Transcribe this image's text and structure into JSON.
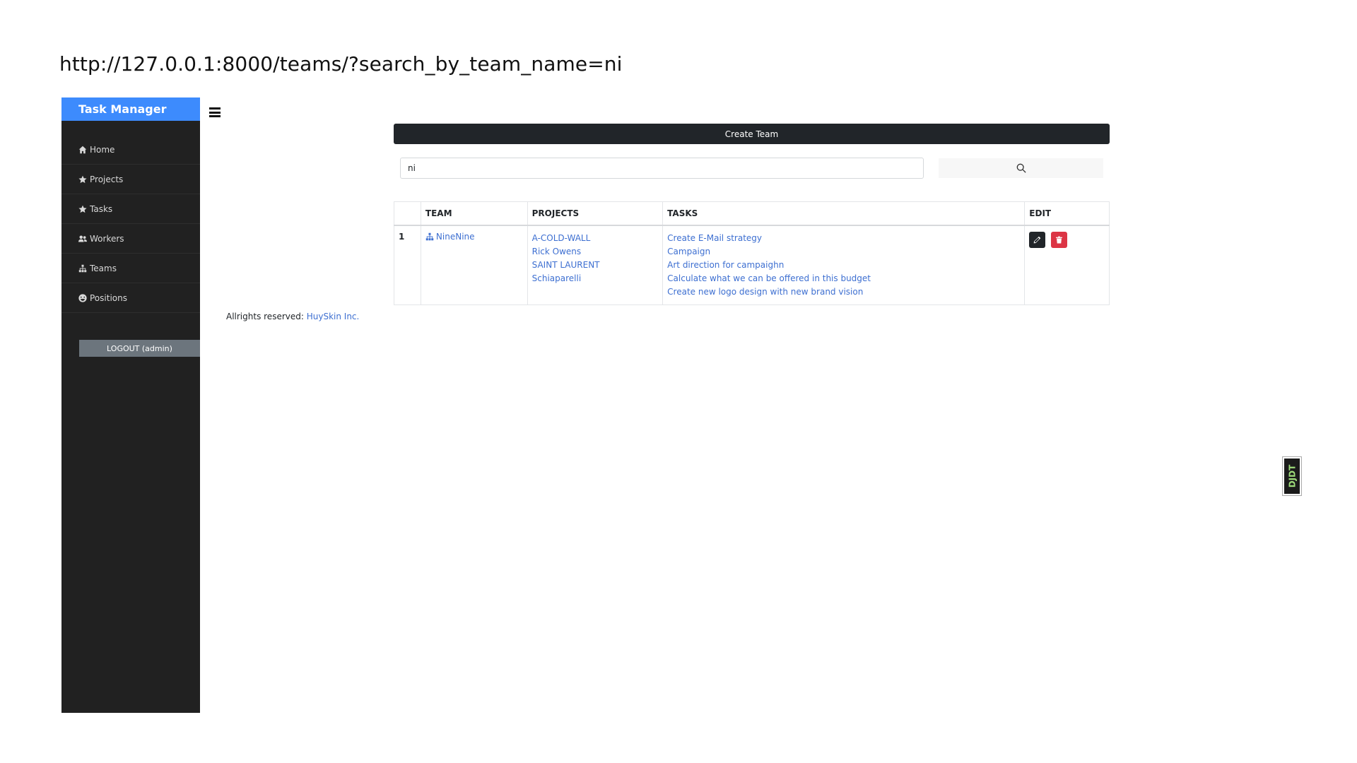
{
  "url_caption": "http://127.0.0.1:8000/teams/?search_by_team_name=ni",
  "sidebar": {
    "brand": "Task Manager",
    "items": [
      {
        "label": "Home",
        "icon": "home-icon"
      },
      {
        "label": "Projects",
        "icon": "star-icon"
      },
      {
        "label": "Tasks",
        "icon": "star-icon"
      },
      {
        "label": "Workers",
        "icon": "users-icon"
      },
      {
        "label": "Teams",
        "icon": "sitemap-icon"
      },
      {
        "label": "Positions",
        "icon": "smile-icon"
      }
    ],
    "logout_label": "LOGOUT (admin)"
  },
  "footer": {
    "text": "Allrights reserved:",
    "link": "HuySkin Inc."
  },
  "main": {
    "create_team_label": "Create Team",
    "search": {
      "value": "ni",
      "button_icon": "search-icon"
    },
    "table": {
      "headers": [
        "",
        "TEAM",
        "PROJECTS",
        "TASKS",
        "EDIT"
      ],
      "rows": [
        {
          "num": "1",
          "team": "NineNine",
          "projects": [
            "A-COLD-WALL",
            "Rick Owens",
            "SAINT LAURENT",
            "Schiaparelli"
          ],
          "tasks": [
            "Create E-Mail strategy",
            "Campaign",
            "Art direction for campaighn",
            "Calculate what we can be offered in this budget",
            "Create new logo design with new brand vision"
          ]
        }
      ]
    }
  },
  "debug_toolbar": {
    "label": "DJDT"
  },
  "colors": {
    "brand": "#3d8bfd",
    "sidebar_bg": "#212121",
    "link": "#3d6fd1",
    "dark_button": "#212529",
    "danger": "#dc3545",
    "logout": "#6c757d"
  }
}
